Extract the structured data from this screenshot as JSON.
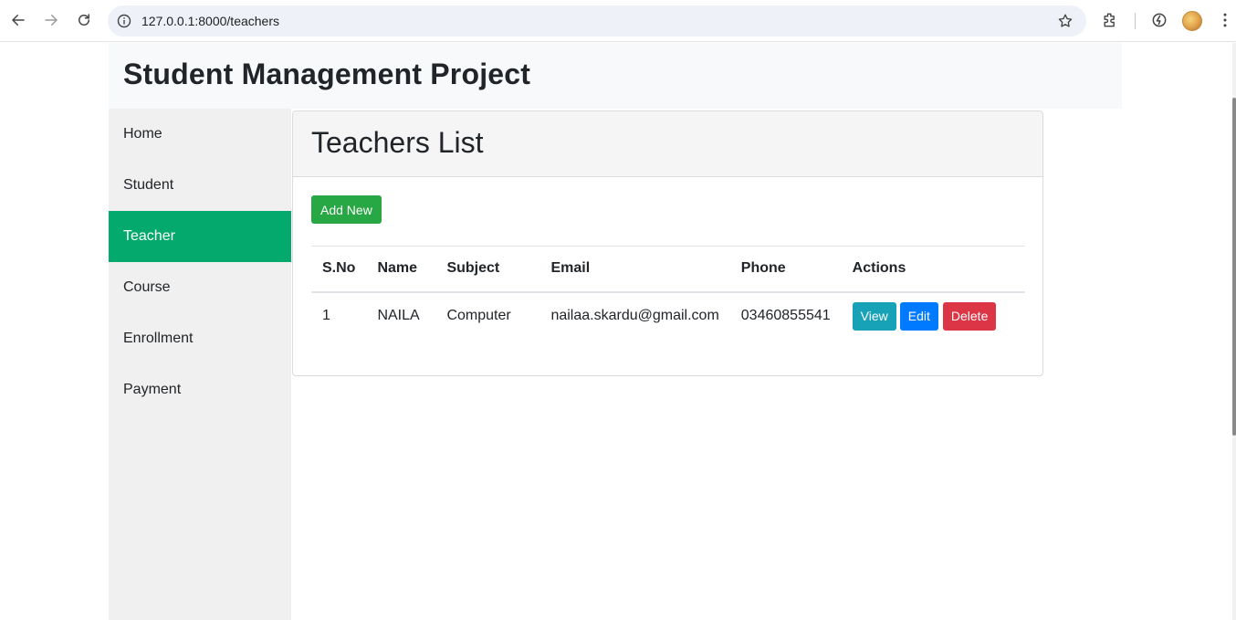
{
  "browser": {
    "url": "127.0.0.1:8000/teachers",
    "icons": [
      "back-arrow-icon",
      "forward-arrow-icon",
      "reload-icon",
      "info-icon",
      "star-icon",
      "extensions-icon",
      "performance-icon",
      "avatar",
      "more-icon"
    ]
  },
  "header": {
    "title": "Student Management Project"
  },
  "sidebar": {
    "items": [
      {
        "label": "Home",
        "active": false
      },
      {
        "label": "Student",
        "active": false
      },
      {
        "label": "Teacher",
        "active": true
      },
      {
        "label": "Course",
        "active": false
      },
      {
        "label": "Enrollment",
        "active": false
      },
      {
        "label": "Payment",
        "active": false
      }
    ],
    "active_color": "#04aa6d"
  },
  "main": {
    "title": "Teachers List",
    "add_button": "Add New",
    "table": {
      "headers": [
        "S.No",
        "Name",
        "Subject",
        "Email",
        "Phone",
        "Actions"
      ],
      "rows": [
        {
          "sno": "1",
          "name": "NAILA",
          "subject": "Computer",
          "email": "nailaa.skardu@gmail.com",
          "phone": "03460855541",
          "actions": {
            "view": "View",
            "edit": "Edit",
            "delete": "Delete"
          }
        }
      ]
    }
  },
  "colors": {
    "add": "#28a745",
    "view": "#17a2b8",
    "edit": "#007bff",
    "delete": "#dc3545"
  }
}
